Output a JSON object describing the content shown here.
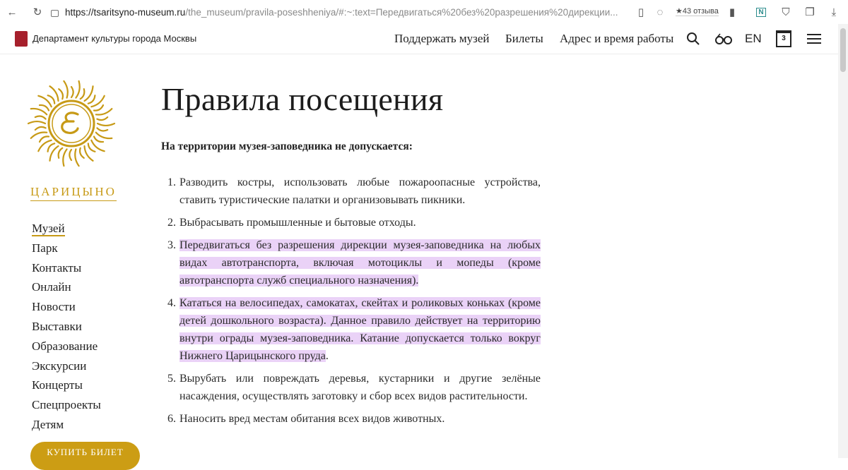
{
  "browser": {
    "url_host": "https://tsaritsyno-museum.ru",
    "url_path": "/the_museum/pravila-poseshheniya/#:~:text=Передвигаться%20без%20разрешения%20дирекции...",
    "reviews": "★43 отзыва"
  },
  "header": {
    "department": "Департамент культуры города Москвы",
    "nav": [
      "Поддержать музей",
      "Билеты",
      "Адрес и время работы"
    ],
    "lang": "EN",
    "calendar_day": "3"
  },
  "sidebar": {
    "brand": "ЦАРИЦЫНО",
    "items": [
      "Музей",
      "Парк",
      "Контакты",
      "Онлайн",
      "Новости",
      "Выставки",
      "Образование",
      "Экскурсии",
      "Концерты",
      "Спецпроекты",
      "Детям"
    ],
    "buy_button": "КУПИТЬ БИЛЕТ"
  },
  "main": {
    "title": "Правила посещения",
    "subhead": "На территории музея-заповедника не допускается:",
    "rules": [
      {
        "n": "1.",
        "text": "Разводить костры, использовать любые пожароопасные устройства, ставить туристические палатки и организовывать пикники.",
        "tail": ""
      },
      {
        "n": "2.",
        "text": "Выбрасывать промышленные и бытовые отходы.",
        "tail": ""
      },
      {
        "n": "3.",
        "text": "Передвигаться без разрешения дирекции музея-заповедника на любых видах автотранспорта, включая мотоциклы и мопеды (кроме автотранспорта служб специального назначения).",
        "tail": ""
      },
      {
        "n": "4.",
        "text": "Кататься на велосипедах, самокатах, скейтах и роликовых коньках (кроме детей дошкольного возраста). Данное правило действует на территорию внутри ограды музея-заповедника. Катание допускается только вокруг Нижнего Царицынского пруда",
        "tail": "."
      },
      {
        "n": "5.",
        "text": "Вырубать или повреждать деревья, кустарники и другие зелёные насаждения, осуществлять заготовку и сбор всех видов растительности.",
        "tail": ""
      },
      {
        "n": "6.",
        "text": "Наносить вред местам обитания всех видов животных.",
        "tail": ""
      }
    ]
  },
  "colors": {
    "accent_gold": "#c79a16",
    "highlight": "#ead2f7",
    "logo_red": "#a6202c"
  }
}
